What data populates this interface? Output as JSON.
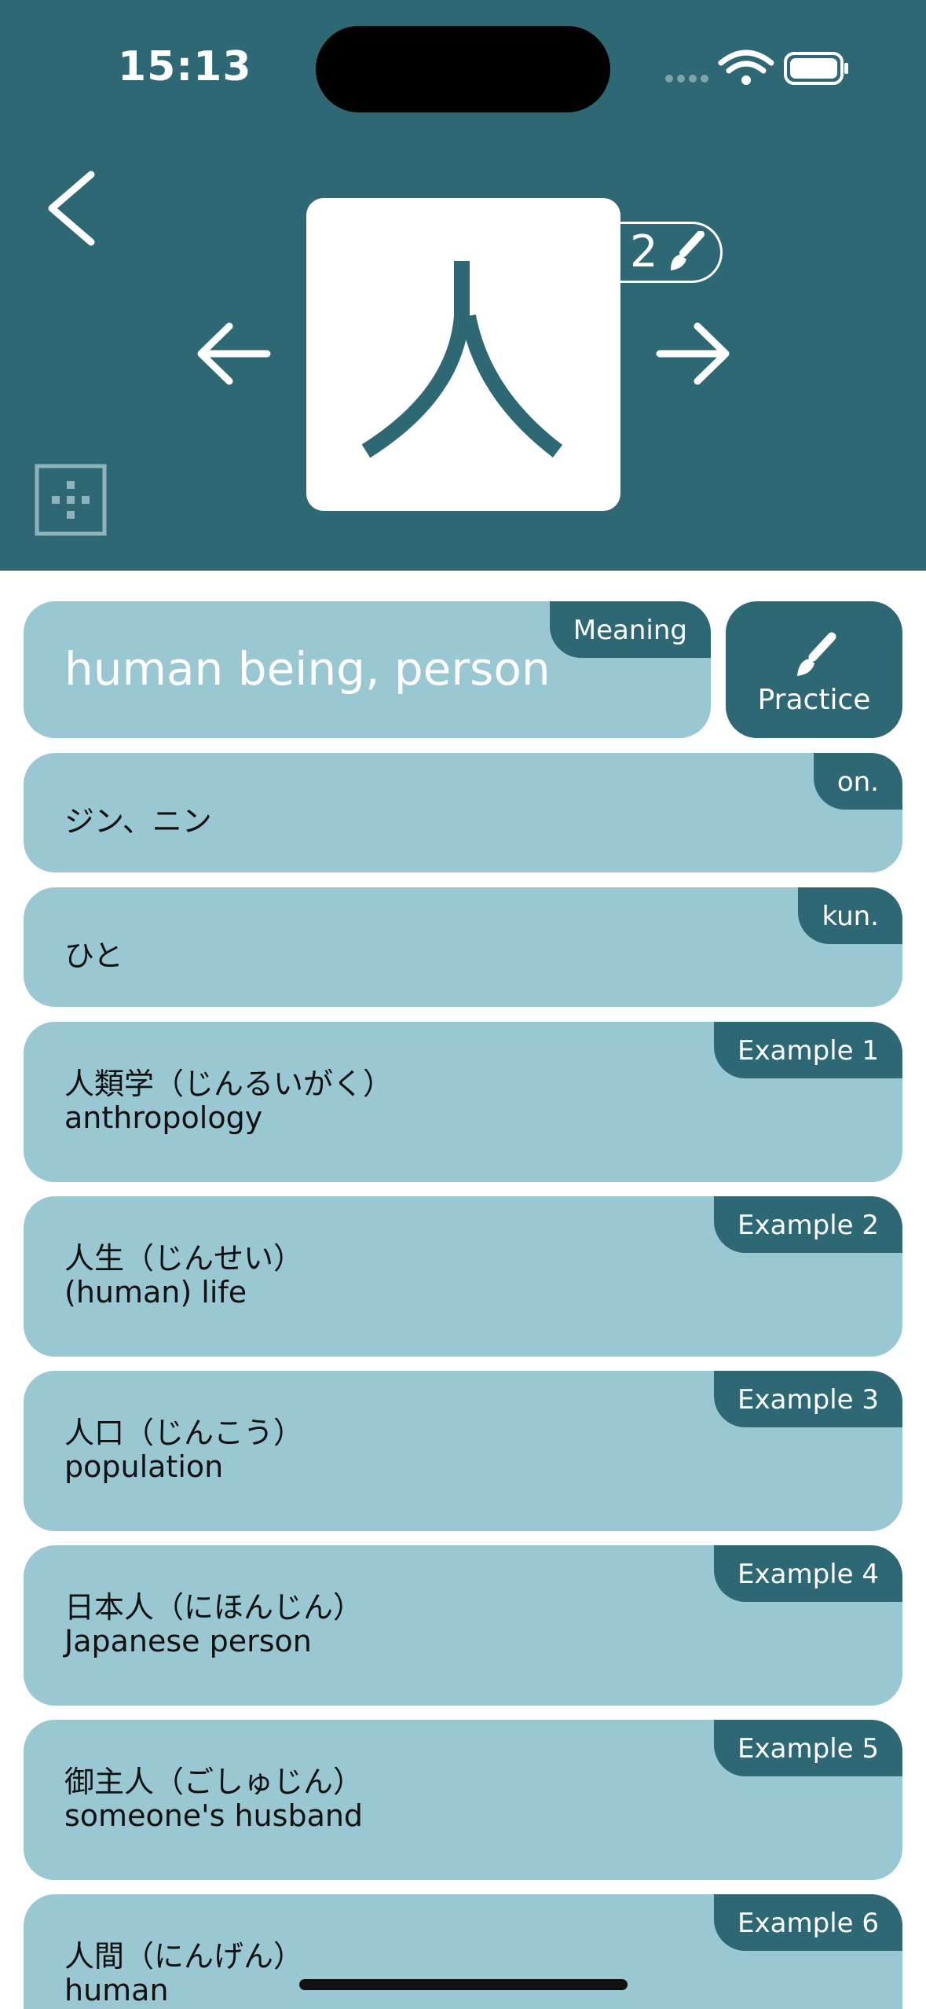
{
  "status_bar": {
    "time": "15:13"
  },
  "kanji": {
    "character": "人",
    "stroke_count": "2"
  },
  "meaning": {
    "tag": "Meaning",
    "text": "human being, person"
  },
  "practice": {
    "label": "Practice"
  },
  "on_reading": {
    "tag": "on.",
    "text": "ジン、ニン"
  },
  "kun_reading": {
    "tag": "kun.",
    "text": "ひと"
  },
  "examples": [
    {
      "tag": "Example 1",
      "word": "人類学（じんるいがく）",
      "meaning": "anthropology"
    },
    {
      "tag": "Example 2",
      "word": "人生（じんせい）",
      "meaning": "(human) life"
    },
    {
      "tag": "Example 3",
      "word": "人口（じんこう）",
      "meaning": "population"
    },
    {
      "tag": "Example 4",
      "word": "日本人（にほんじん）",
      "meaning": "Japanese person"
    },
    {
      "tag": "Example 5",
      "word": "御主人（ごしゅじん）",
      "meaning": "someone's husband"
    },
    {
      "tag": "Example 6",
      "word": "人間（にんげん）",
      "meaning": "human"
    }
  ],
  "icons": {
    "back": "chevron-left-icon",
    "prev": "arrow-left-icon",
    "next": "arrow-right-icon",
    "grid": "grid-icon",
    "brush": "brush-icon"
  },
  "colors": {
    "header_bg": "#2e6874",
    "card_bg": "#99c8d3",
    "accent": "#2e6874"
  }
}
